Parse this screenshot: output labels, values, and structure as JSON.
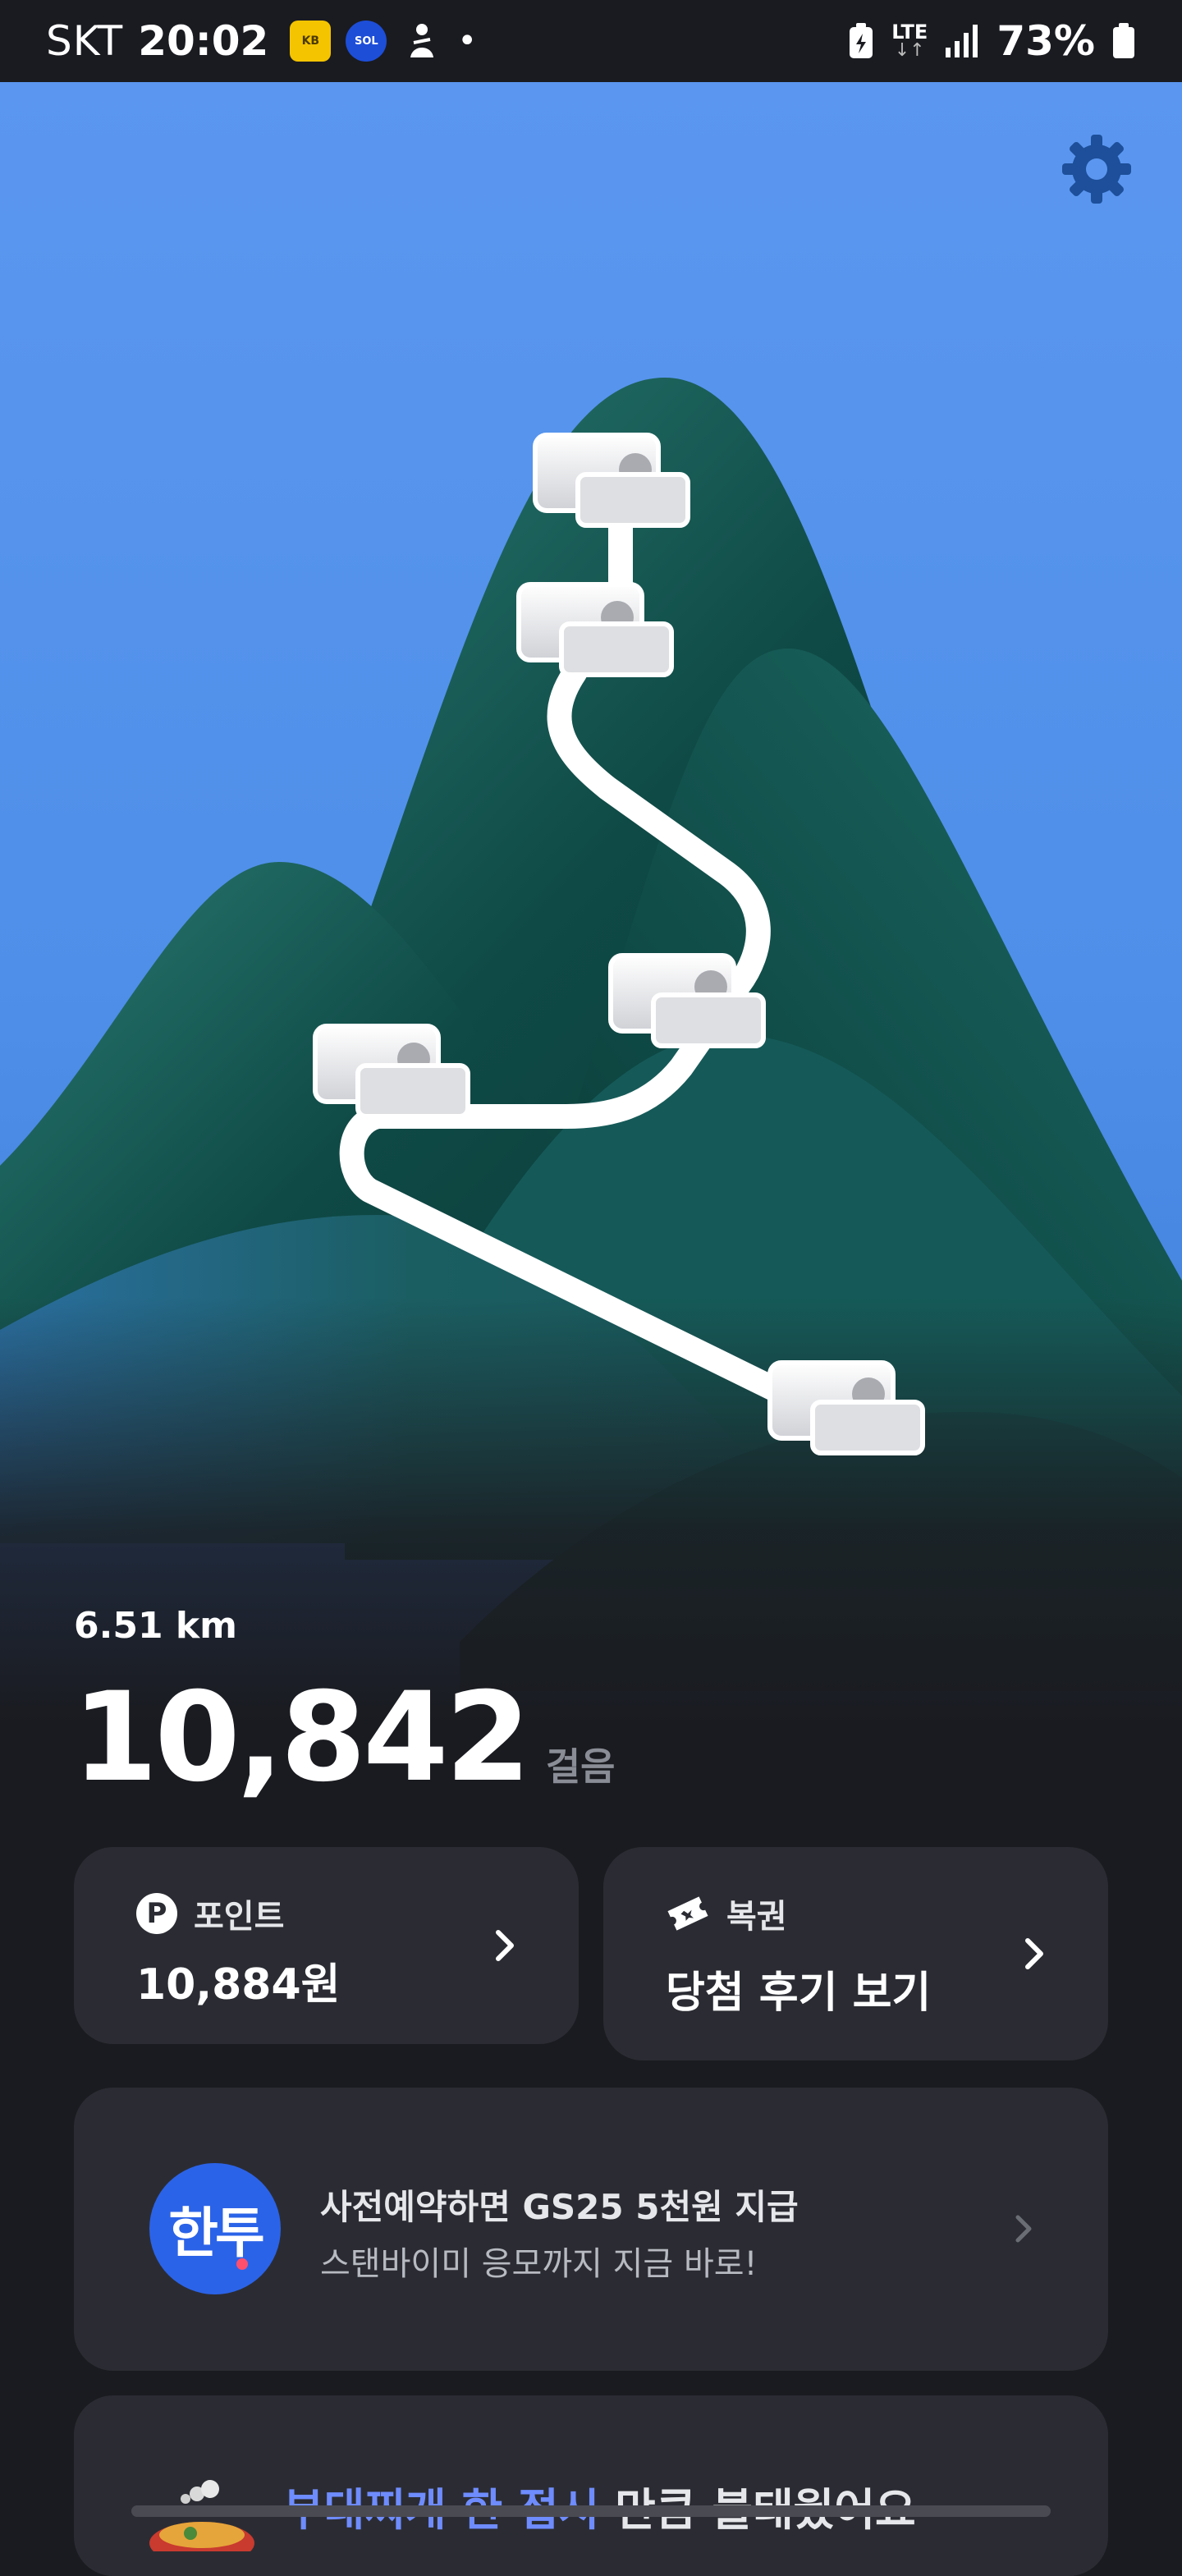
{
  "status_bar": {
    "carrier": "SKT",
    "time": "20:02",
    "network": "LTE",
    "battery_percent": "73%",
    "icons": [
      "kb-bank-app-icon",
      "super-sol-app-icon",
      "person-app-icon",
      "notification-dot",
      "battery-saver-icon",
      "lte-icon",
      "signal-icon",
      "battery-icon"
    ]
  },
  "colors": {
    "sky": "#5b97f0",
    "mountain_dark": "#0f4a46",
    "mountain_mid": "#2a7a72",
    "background": "#1a1b20",
    "card": "#2b2c33",
    "highlight": "#6f8cff",
    "settings_icon": "#1d4f9a"
  },
  "hero": {
    "settings_icon": "gear-icon",
    "distance": "6.51 km",
    "steps": "10,842",
    "steps_unit": "걸음"
  },
  "cards": {
    "points": {
      "icon": "p-icon",
      "icon_text": "P",
      "label": "포인트",
      "value": "10,884원"
    },
    "lottery": {
      "icon": "ticket-icon",
      "label": "복권",
      "value": "당첨 후기 보기"
    }
  },
  "promo": {
    "logo_text": "한투",
    "title": "사전예약하면 GS25 5천원 지급",
    "subtitle": "스탠바이미 응모까지 지금 바로!"
  },
  "bottom_card": {
    "highlight": "부대찌개 한 접시",
    "rest": " 만큼 불태웠어요"
  }
}
